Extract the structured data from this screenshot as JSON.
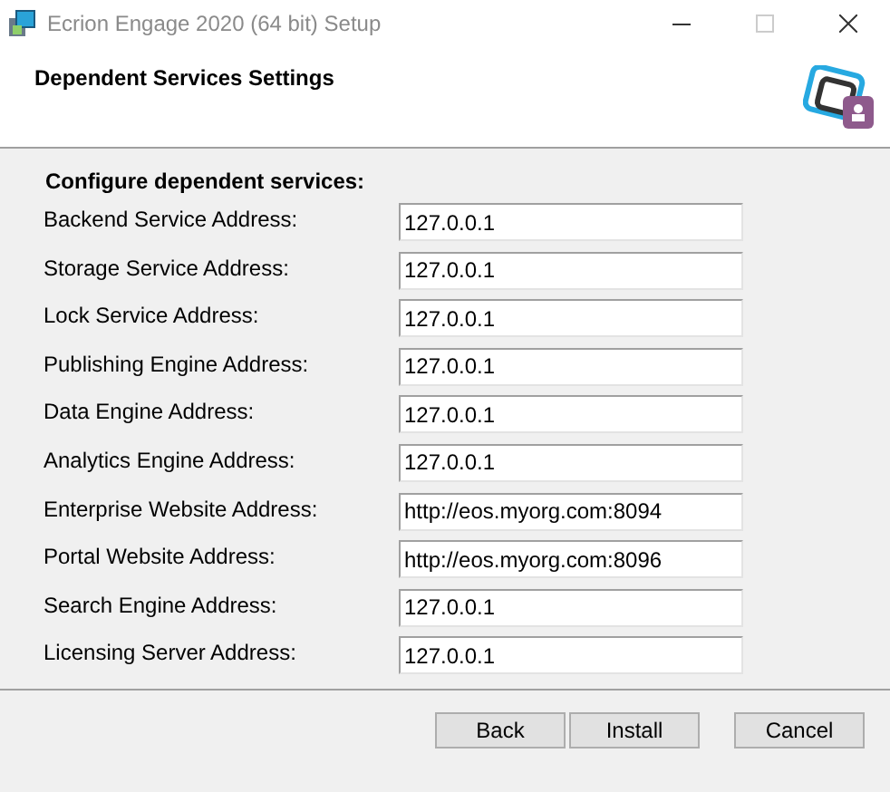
{
  "window": {
    "title": "Ecrion Engage 2020 (64 bit) Setup",
    "controls": [
      {
        "kind": "minimize",
        "disabled": false
      },
      {
        "kind": "maximize",
        "disabled": true
      },
      {
        "kind": "close",
        "disabled": false
      }
    ]
  },
  "header": {
    "title": "Dependent Services Settings"
  },
  "section": {
    "title": "Configure dependent services:"
  },
  "fields": [
    {
      "label": "Backend Service Address:",
      "value": "127.0.0.1"
    },
    {
      "label": "Storage Service Address:",
      "value": "127.0.0.1"
    },
    {
      "label": "Lock Service Address:",
      "value": "127.0.0.1"
    },
    {
      "label": "Publishing Engine Address:",
      "value": "127.0.0.1"
    },
    {
      "label": "Data Engine Address:",
      "value": "127.0.0.1"
    },
    {
      "label": "Analytics Engine Address:",
      "value": "127.0.0.1"
    },
    {
      "label": "Enterprise Website Address:",
      "value": "http://eos.myorg.com:8094"
    },
    {
      "label": "Portal Website Address:",
      "value": "http://eos.myorg.com:8096"
    },
    {
      "label": "Search Engine Address:",
      "value": "127.0.0.1"
    },
    {
      "label": "Licensing Server Address:",
      "value": "127.0.0.1"
    }
  ],
  "buttons": [
    "Back",
    "Install",
    "Cancel"
  ]
}
